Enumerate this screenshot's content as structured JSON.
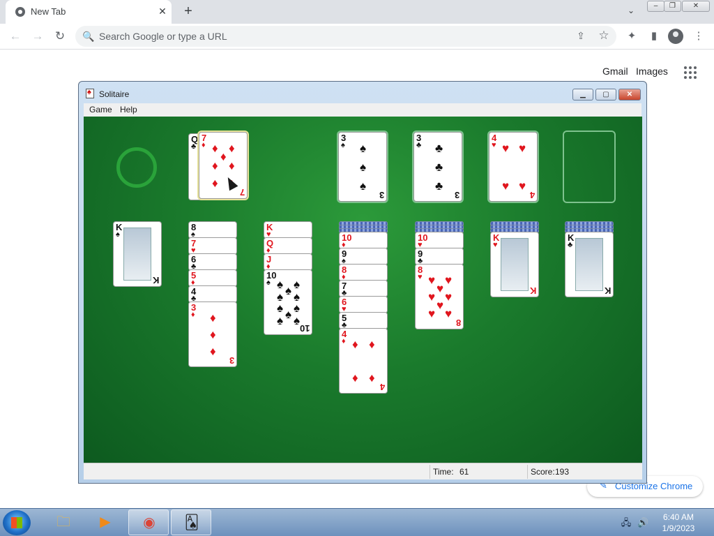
{
  "browser": {
    "tab_title": "New Tab",
    "tab_close": "✕",
    "newtab_label": "+",
    "tabsearch_label": "⌄",
    "win_min": "–",
    "win_restore": "❐",
    "win_close": "✕",
    "omnibox_placeholder": "Search Google or type a URL",
    "icons": {
      "back": "←",
      "forward": "→",
      "reload": "↻",
      "search": "🔍",
      "share": "⇪",
      "star": "☆",
      "extensions": "✦",
      "sidepanel": "▮",
      "menu": "⋮"
    }
  },
  "ntp": {
    "gmail_label": "Gmail",
    "images_label": "Images",
    "customize_label": "Customize Chrome",
    "customize_icon": "✎"
  },
  "solitaire": {
    "title": "Solitaire",
    "menu": [
      "Game",
      "Help"
    ],
    "controls": {
      "min": "▁",
      "max": "▢",
      "close": "✕"
    },
    "status": {
      "time_label": "Time:",
      "time_value": "61",
      "score_label": "Score:",
      "score_value": "193"
    },
    "colors": {
      "felt": "#1a7a2c",
      "red_suit": "#e0161e",
      "black_suit": "#111111"
    },
    "waste": [
      {
        "rank": "Q",
        "suit": "♣"
      },
      {
        "rank": "7",
        "suit": "♦"
      }
    ],
    "foundations": [
      {
        "rank": "3",
        "suit": "♠"
      },
      {
        "rank": "3",
        "suit": "♣"
      },
      {
        "rank": "4",
        "suit": "♥"
      },
      null
    ],
    "tableau": [
      {
        "hidden": 0,
        "cards": [
          {
            "rank": "K",
            "suit": "♠"
          }
        ]
      },
      {
        "hidden": 0,
        "cards": [
          {
            "rank": "8",
            "suit": "♠"
          },
          {
            "rank": "7",
            "suit": "♥"
          },
          {
            "rank": "6",
            "suit": "♣"
          },
          {
            "rank": "5",
            "suit": "♦"
          },
          {
            "rank": "4",
            "suit": "♣"
          },
          {
            "rank": "3",
            "suit": "♦"
          }
        ]
      },
      {
        "hidden": 0,
        "cards": [
          {
            "rank": "K",
            "suit": "♥"
          },
          {
            "rank": "Q",
            "suit": "♦"
          },
          {
            "rank": "J",
            "suit": "♦"
          },
          {
            "rank": "10",
            "suit": "♠"
          }
        ]
      },
      {
        "hidden": 3,
        "cards": [
          {
            "rank": "10",
            "suit": "♦"
          },
          {
            "rank": "9",
            "suit": "♠"
          },
          {
            "rank": "8",
            "suit": "♦"
          },
          {
            "rank": "7",
            "suit": "♣"
          },
          {
            "rank": "6",
            "suit": "♥"
          },
          {
            "rank": "5",
            "suit": "♣"
          },
          {
            "rank": "4",
            "suit": "♦"
          }
        ]
      },
      {
        "hidden": 3,
        "cards": [
          {
            "rank": "10",
            "suit": "♥"
          },
          {
            "rank": "9",
            "suit": "♣"
          },
          {
            "rank": "8",
            "suit": "♥"
          }
        ]
      },
      {
        "hidden": 3,
        "cards": [
          {
            "rank": "K",
            "suit": "♥"
          }
        ]
      },
      {
        "hidden": 3,
        "cards": [
          {
            "rank": "K",
            "suit": "♣"
          }
        ]
      }
    ]
  },
  "taskbar": {
    "items": [
      {
        "name": "explorer",
        "glyph": "🗀"
      },
      {
        "name": "media-player",
        "glyph": "▶"
      },
      {
        "name": "chrome",
        "glyph": "◉"
      },
      {
        "name": "solitaire",
        "glyph": "🂡"
      }
    ],
    "tray": {
      "network": "🖧",
      "volume": "🔊"
    },
    "time": "6:40 AM",
    "date": "1/9/2023"
  }
}
